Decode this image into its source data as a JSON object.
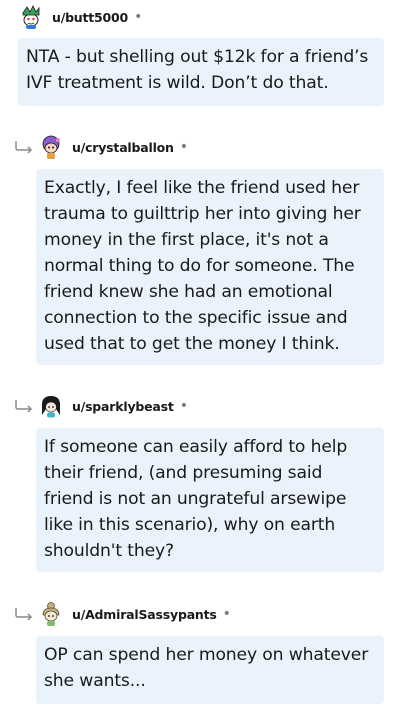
{
  "comments": [
    {
      "username": "u/butt5000",
      "separator": "•",
      "avatar_icon": "snoo-avatar-green-icon",
      "body": "NTA - but shelling out $12k for a friend’s IVF treatment is wild. Don’t do that."
    },
    {
      "username": "u/crystalballon",
      "separator": "•",
      "avatar_icon": "snoo-avatar-purple-icon",
      "body": "Exactly, I feel like the friend used her trauma to guilttrip her into giving her money in the first place, it's not a normal thing to do for someone. The friend knew she had an emotional connection to the specific issue and used that to get the money I think."
    },
    {
      "username": "u/sparklybeast",
      "separator": "•",
      "avatar_icon": "snoo-avatar-dark-hair-icon",
      "body": "If someone can easily afford to help their friend, (and presuming said friend is not an ungrateful arsewipe like in this scenario), why on earth shouldn't they?"
    },
    {
      "username": "u/AdmiralSassypants",
      "separator": "•",
      "avatar_icon": "snoo-avatar-bun-icon",
      "body": "OP can spend her money on whatever she wants..."
    }
  ],
  "colors": {
    "bubble_bg": "#eaf3fb",
    "text": "#1a1a1b",
    "meta": "#7c7c7c"
  }
}
